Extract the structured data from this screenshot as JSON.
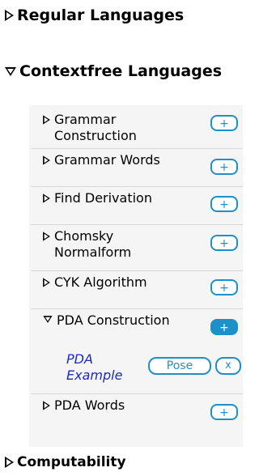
{
  "sections": [
    {
      "label": "Regular Languages",
      "expanded": false
    },
    {
      "label": "Contextfree Languages",
      "expanded": true
    },
    {
      "label": "Computability",
      "expanded": false
    }
  ],
  "items": [
    {
      "label_lines": [
        "Grammar",
        "Construction"
      ],
      "expanded": false,
      "button": "+"
    },
    {
      "label_lines": [
        "Grammar Words"
      ],
      "expanded": false,
      "button": "+"
    },
    {
      "label_lines": [
        "Find Derivation"
      ],
      "expanded": false,
      "button": "+"
    },
    {
      "label_lines": [
        "Chomsky",
        "Normalform"
      ],
      "expanded": false,
      "button": "+"
    },
    {
      "label_lines": [
        "CYK Algorithm"
      ],
      "expanded": false,
      "button": "+"
    },
    {
      "label_lines": [
        "PDA Construction"
      ],
      "expanded": true,
      "button": "+"
    },
    {
      "label_lines": [
        "PDA Words"
      ],
      "expanded": false,
      "button": "+"
    }
  ],
  "example": {
    "label_lines": [
      "PDA",
      "Example"
    ],
    "pose_label": "Pose",
    "remove_label": "x"
  },
  "colors": {
    "accent": "#1e90c8",
    "link": "#1a2bb8",
    "panel_bg": "#f5f5f5"
  }
}
